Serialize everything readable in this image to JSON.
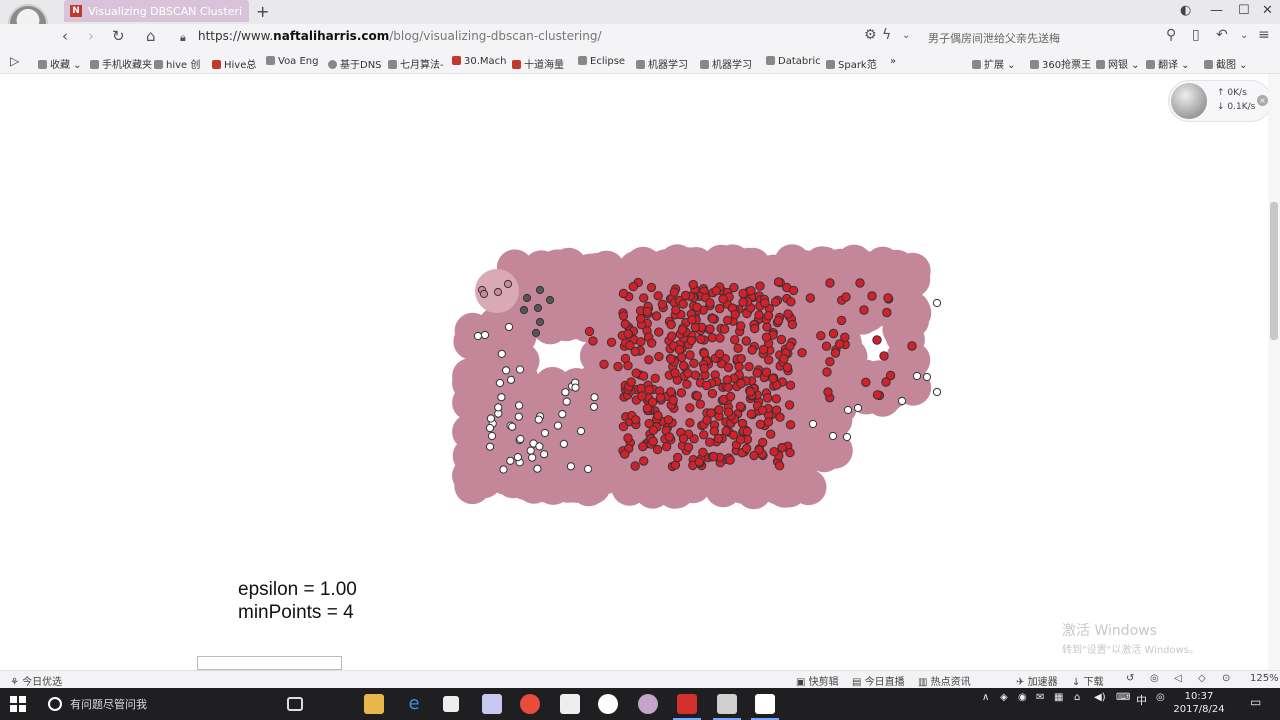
{
  "tab": {
    "title": "Visualizing DBSCAN Clusteri",
    "favicon_text": "N"
  },
  "address": {
    "scheme": "https://www.",
    "host": "naftaliharris.com",
    "path": "/blog/visualizing-dbscan-clustering/",
    "right_text": "男子偶房间泄给父亲先送梅"
  },
  "bookmarks": [
    {
      "label": "收藏",
      "icon": "star-icon"
    },
    {
      "label": "手机收藏夹",
      "icon": "phone-icon"
    },
    {
      "label": "hive 创",
      "icon": "page-icon"
    },
    {
      "label": "Hive总",
      "icon": "red-c-icon"
    },
    {
      "label": "Voa Eng",
      "icon": "page-icon"
    },
    {
      "label": "基于DNS",
      "icon": "page-icon"
    },
    {
      "label": "七月算法-",
      "icon": "page-icon"
    },
    {
      "label": "30.Mach",
      "icon": "red-c-icon"
    },
    {
      "label": "十道海量",
      "icon": "red-c-icon"
    },
    {
      "label": "Eclipse",
      "icon": "page-icon"
    },
    {
      "label": "机器学习",
      "icon": "page-icon"
    },
    {
      "label": "机器学习",
      "icon": "page-icon"
    },
    {
      "label": "Databric",
      "icon": "page-icon"
    },
    {
      "label": "Spark范",
      "icon": "page-icon"
    },
    {
      "label": "»",
      "icon": ""
    },
    {
      "label": "扩展",
      "icon": "grid-icon"
    },
    {
      "label": "360抢票王",
      "icon": "page-icon"
    },
    {
      "label": "网银",
      "icon": "page-icon"
    },
    {
      "label": "翻译",
      "icon": "page-icon"
    },
    {
      "label": "截图",
      "icon": "scissors-icon"
    }
  ],
  "speed_widget": {
    "up": "0K/s",
    "down": "0.1K/s"
  },
  "params": {
    "epsilon": "epsilon = 1.00",
    "minpoints": "minPoints = 4"
  },
  "colors": {
    "halo": "#c4879a",
    "halo_single": "#d9a9b8",
    "core_fill": "#d3202a",
    "border_fill": "#c98a9b",
    "noise_fill": "#ffffff",
    "point_stroke": "#333333",
    "dark_fill": "#555555"
  },
  "status_bar": {
    "left": "今日优选",
    "items": [
      "快剪辑",
      "今日直播",
      "热点资讯",
      "加速器",
      "下载",
      "125%"
    ]
  },
  "watermark": {
    "line1": "激活 Windows",
    "line2": "转到\"设置\"以激活 Windows。"
  },
  "taskbar": {
    "search_text": "有问题尽管问我",
    "tray_ime": "中",
    "time": "10:37",
    "date": "2017/8/24"
  }
}
